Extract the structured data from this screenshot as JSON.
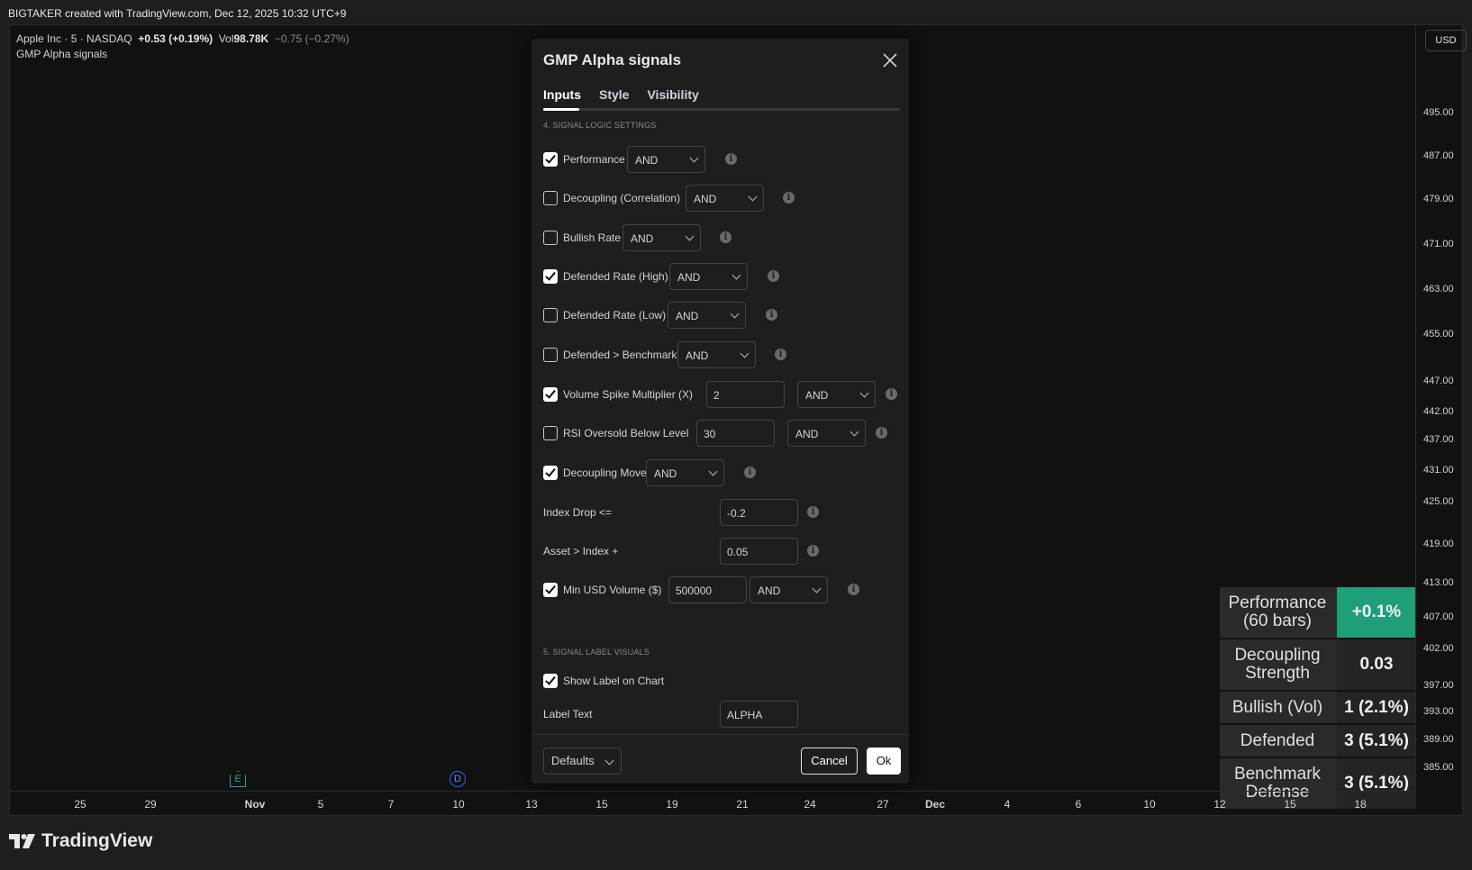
{
  "topbar": {
    "text": "BIGTAKER created with TradingView.com, Dec 12, 2025 10:32 UTC+9"
  },
  "legend": {
    "symbol": "Apple Inc · 5 · NASDAQ",
    "change": "+0.53 (+0.19%)",
    "vol_label": "Vol",
    "vol_value": "98.78K",
    "vol_change": "−0.75 (−0.27%)",
    "indicator": "GMP Alpha signals"
  },
  "price_axis": {
    "currency": "USD",
    "ticks": [
      "495.00",
      "487.00",
      "479.00",
      "471.00",
      "463.00",
      "455.00",
      "447.00",
      "442.00",
      "437.00",
      "431.00",
      "425.00",
      "419.00",
      "413.00",
      "407.00",
      "402.00",
      "397.00",
      "393.00",
      "389.00",
      "385.00"
    ]
  },
  "time_axis": {
    "ticks": [
      "25",
      "29",
      "Nov",
      "5",
      "7",
      "10",
      "13",
      "15",
      "19",
      "21",
      "24",
      "27",
      "Dec",
      "4",
      "6",
      "10",
      "12",
      "15",
      "18"
    ]
  },
  "events": {
    "earnings": "E",
    "dividend": "D"
  },
  "stats": [
    {
      "label": "Performance (60 bars)",
      "value": "+0.1%",
      "color": "#1f9e7a"
    },
    {
      "label": "Decoupling Strength",
      "value": "0.03"
    },
    {
      "label": "Bullish (Vol)",
      "value": "1 (2.1%)"
    },
    {
      "label": "Defended",
      "value": "3 (5.1%)"
    },
    {
      "label": "Benchmark Defense",
      "value": "3 (5.1%)"
    }
  ],
  "dialog": {
    "title": "GMP Alpha signals",
    "tabs": [
      "Inputs",
      "Style",
      "Visibility"
    ],
    "section4": "4. SIGNAL LOGIC SETTINGS",
    "section5": "5. SIGNAL LABEL VISUALS",
    "rows": [
      {
        "label": "Performance",
        "checked": true,
        "op": "AND"
      },
      {
        "label": "Decoupling (Correlation)",
        "checked": false,
        "op": "AND"
      },
      {
        "label": "Bullish Rate",
        "checked": false,
        "op": "AND"
      },
      {
        "label": "Defended Rate (High)",
        "checked": true,
        "op": "AND"
      },
      {
        "label": "Defended Rate (Low)",
        "checked": false,
        "op": "AND"
      },
      {
        "label": "Defended > Benchmark",
        "checked": false,
        "op": "AND"
      },
      {
        "label": "Volume Spike  Multiplier (X)",
        "checked": true,
        "value": "2",
        "op": "AND"
      },
      {
        "label": "RSI Oversold  Below Level",
        "checked": false,
        "value": "30",
        "op": "AND"
      },
      {
        "label": "Decoupling Move",
        "checked": true,
        "op": "AND"
      },
      {
        "label": "Index Drop <=",
        "value": "-0.2"
      },
      {
        "label": "Asset > Index +",
        "value": "0.05"
      },
      {
        "label": "Min USD Volume  ($)",
        "checked": true,
        "value": "500000",
        "op": "AND"
      }
    ],
    "show_label": {
      "label": "Show Label on Chart",
      "checked": true
    },
    "label_text": {
      "label": "Label Text",
      "value": "ALPHA"
    },
    "buttons": {
      "defaults": "Defaults",
      "cancel": "Cancel",
      "ok": "Ok"
    }
  },
  "brand": "TradingView"
}
